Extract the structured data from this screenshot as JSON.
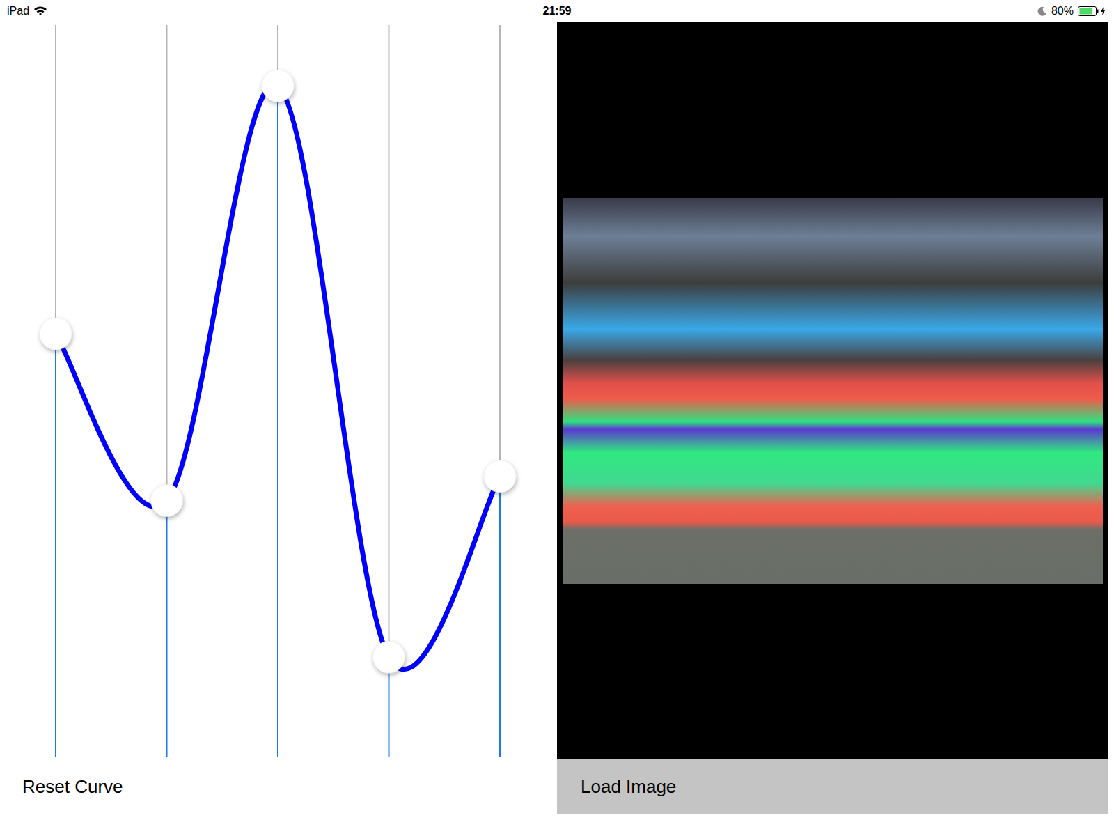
{
  "status_bar": {
    "device": "iPad",
    "time": "21:59",
    "battery": "80%",
    "battery_level": 0.8,
    "charging": true
  },
  "curve": {
    "levels": [
      0.578,
      0.35,
      0.917,
      0.136,
      0.383
    ]
  },
  "buttons": {
    "reset": "Reset Curve",
    "load": "Load Image"
  }
}
